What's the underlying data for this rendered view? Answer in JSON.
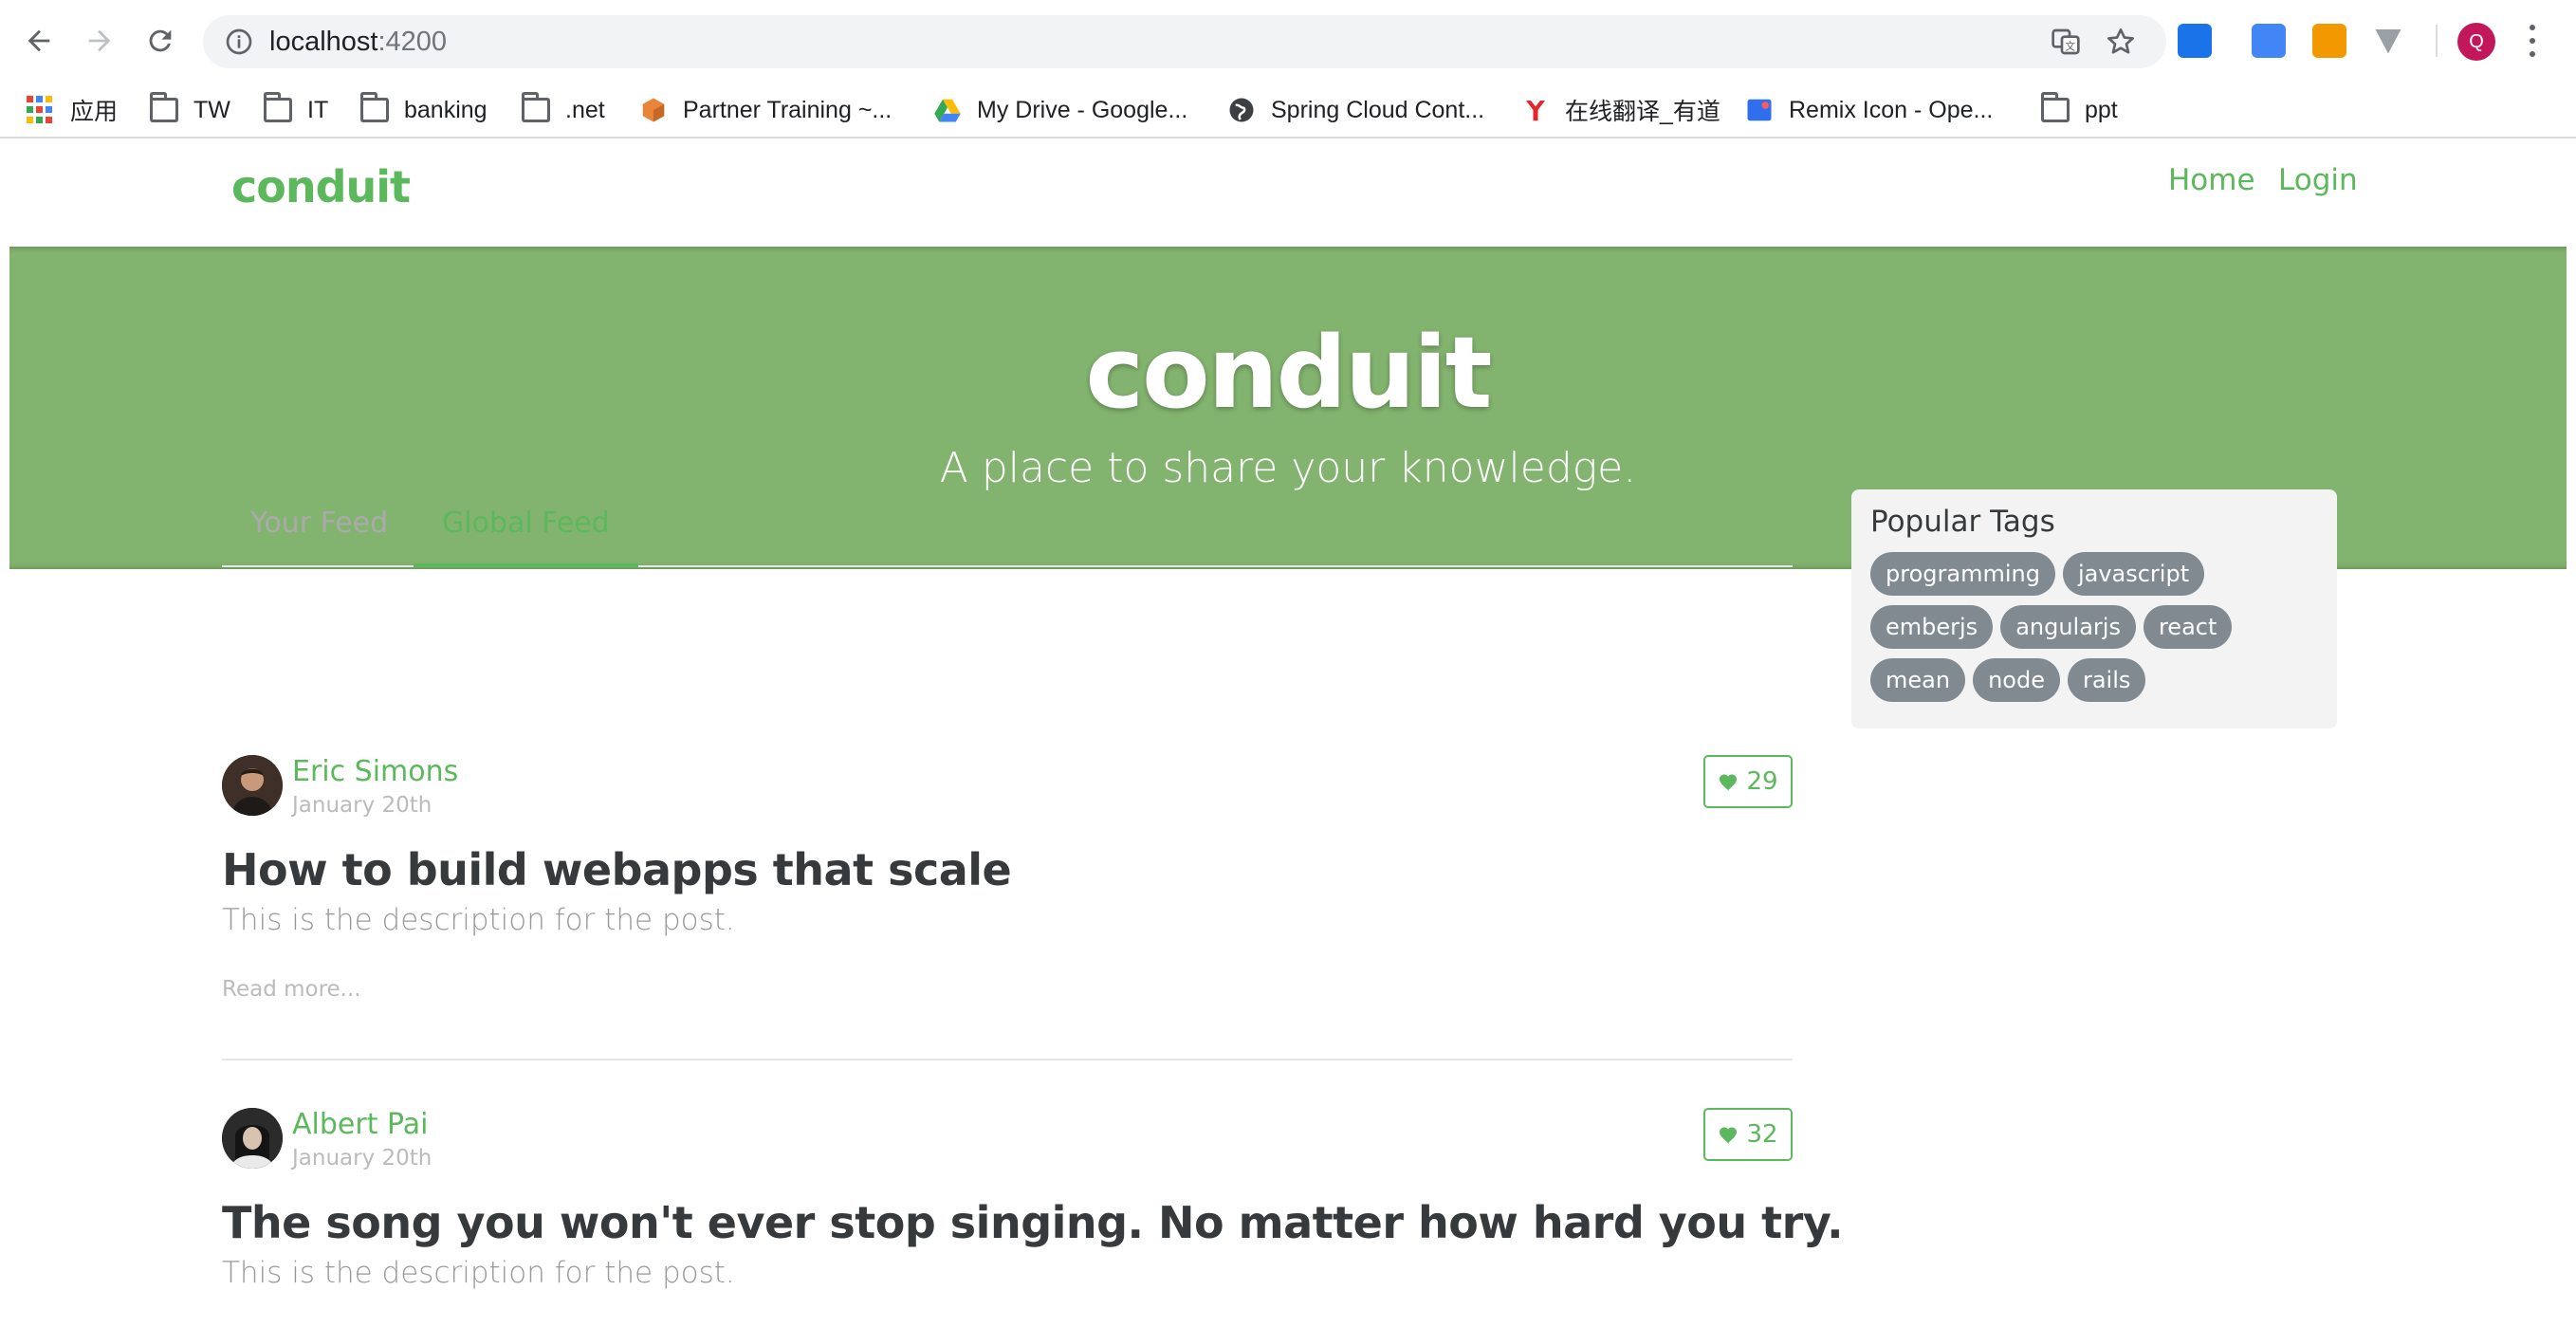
{
  "browser": {
    "url_host": "localhost",
    "url_port": ":4200",
    "profile_initial": "Q",
    "extensions": [
      {
        "name": "s-extension-icon",
        "color": "#1a73e8"
      },
      {
        "name": "translate-extension-icon",
        "color": "#4285f4"
      },
      {
        "name": "orange-extension-icon",
        "color": "#f29900"
      },
      {
        "name": "v-extension-icon",
        "color": "#9aa0a6"
      }
    ],
    "bookmarks": [
      {
        "label": "应用",
        "icon": "apps-icon"
      },
      {
        "label": "TW",
        "icon": "folder-icon"
      },
      {
        "label": "IT",
        "icon": "folder-icon"
      },
      {
        "label": "banking",
        "icon": "folder-icon"
      },
      {
        "label": ".net",
        "icon": "folder-icon"
      },
      {
        "label": "Partner Training ~...",
        "icon": "box-icon"
      },
      {
        "label": "My Drive - Google...",
        "icon": "drive-icon"
      },
      {
        "label": "Spring Cloud Cont...",
        "icon": "globe-icon"
      },
      {
        "label": "在线翻译_有道",
        "icon": "youdao-icon"
      },
      {
        "label": "Remix Icon - Ope...",
        "icon": "remix-icon"
      },
      {
        "label": "ppt",
        "icon": "folder-icon"
      }
    ]
  },
  "navbar": {
    "brand": "conduit",
    "links": [
      "Home",
      "Login"
    ]
  },
  "banner": {
    "title": "conduit",
    "subtitle": "A place to share your knowledge."
  },
  "feed": {
    "tabs": [
      "Your Feed",
      "Global Feed"
    ],
    "active_tab": "Global Feed",
    "articles": [
      {
        "author": "Eric Simons",
        "date": "January 20th",
        "favorites": "29",
        "title": "How to build webapps that scale",
        "description": "This is the description for the post.",
        "read_more": "Read more..."
      },
      {
        "author": "Albert Pai",
        "date": "January 20th",
        "favorites": "32",
        "title": "The song you won't ever stop singing. No matter how hard you try.",
        "description": "This is the description for the post."
      }
    ]
  },
  "sidebar": {
    "title": "Popular Tags",
    "tags": [
      "programming",
      "javascript",
      "emberjs",
      "angularjs",
      "react",
      "mean",
      "node",
      "rails"
    ]
  },
  "colors": {
    "brand_green": "#5cb85c",
    "banner_green": "#83b46f",
    "tag_gray": "#818a91"
  }
}
